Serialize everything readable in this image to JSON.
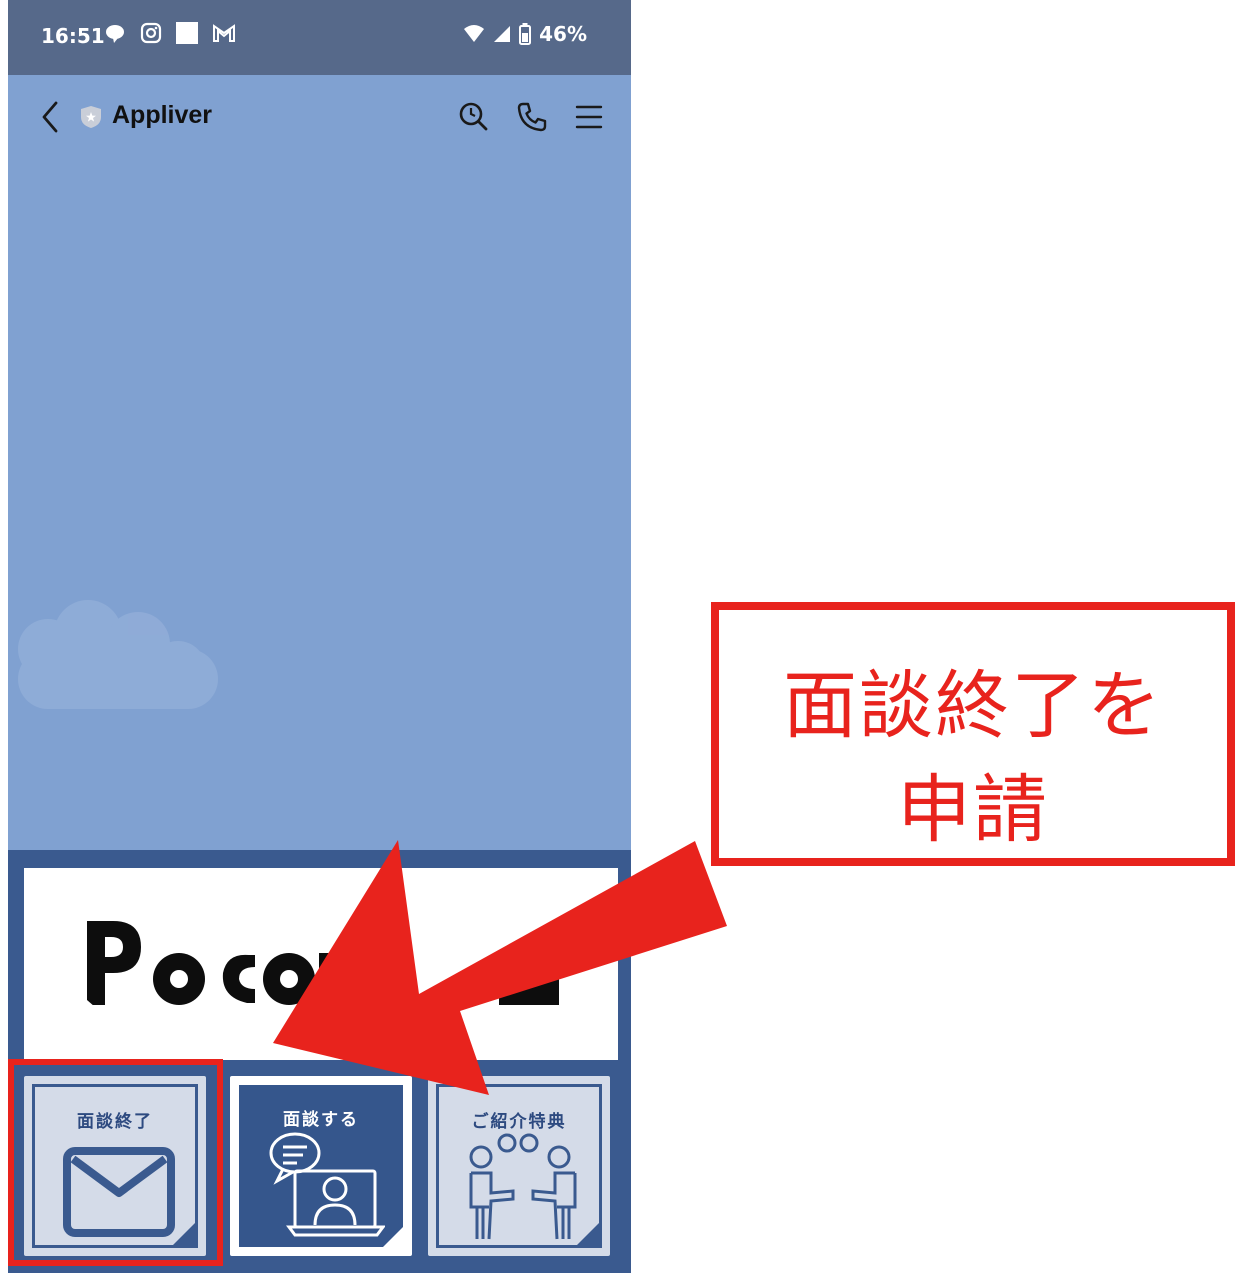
{
  "status_bar": {
    "time": "16:51",
    "battery": "46%",
    "left_icons": [
      "chat-bubble-icon",
      "instagram-icon",
      "square-icon",
      "gmail-icon"
    ],
    "right_icons": [
      "wifi-icon",
      "signal-icon",
      "battery-icon"
    ]
  },
  "chat_header": {
    "title": "Appliver",
    "icons": [
      "back-icon",
      "shield-icon",
      "search-icon",
      "phone-icon",
      "menu-icon"
    ]
  },
  "rich_menu": {
    "tiles": [
      {
        "label": "面談終了",
        "icon": "envelope-icon"
      },
      {
        "label": "面談する",
        "icon": "video-chat-icon"
      },
      {
        "label": "ご紹介特典",
        "icon": "people-handshake-icon"
      }
    ]
  },
  "annotation": {
    "line1": "面談終了を",
    "line2": "申請",
    "color": "#e8231d"
  },
  "colors": {
    "chat_background": "#80a1d1",
    "status_bar": "#56698a",
    "rich_menu_navy": "#3a5a8f",
    "accent_red": "#e8231d"
  }
}
